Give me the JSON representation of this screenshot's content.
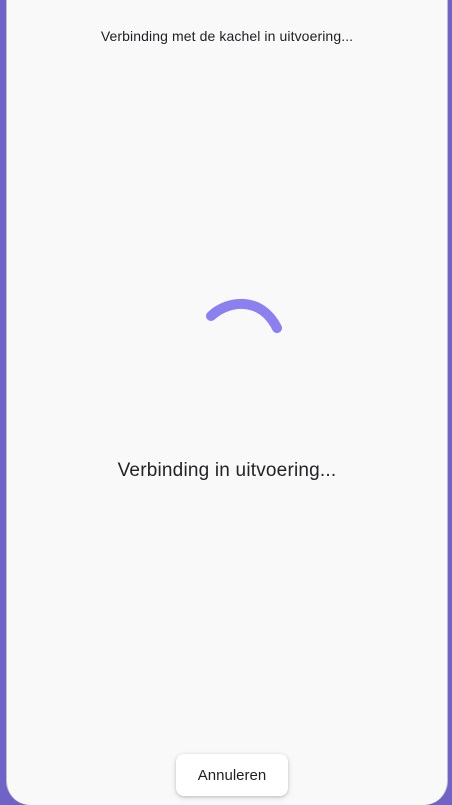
{
  "header": {
    "title": "Verbinding met de kachel in uitvoering..."
  },
  "status": {
    "message": "Verbinding in uitvoering..."
  },
  "actions": {
    "cancel_label": "Annuleren"
  },
  "theme": {
    "accent": "#8c7ff0",
    "backdrop": "#6f63c8",
    "surface": "#f9f9fa"
  },
  "icons": {
    "spinner": "loading-spinner-icon"
  }
}
